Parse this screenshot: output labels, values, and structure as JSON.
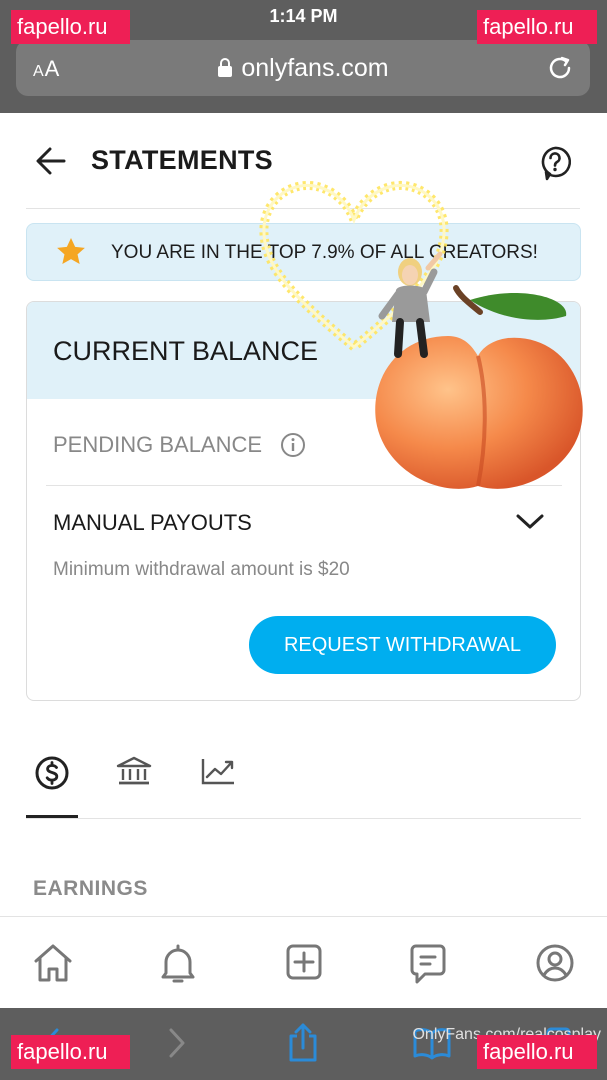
{
  "status_bar": {
    "time": "1:14 PM"
  },
  "browser": {
    "text_size_label": "AA",
    "url": "onlyfans.com",
    "icons": [
      "lock-icon",
      "reload-icon",
      "back-icon",
      "forward-icon",
      "share-icon",
      "bookmarks-icon",
      "tabs-icon"
    ]
  },
  "header": {
    "title": "STATEMENTS",
    "back_icon": "arrow-left-icon",
    "help_icon": "question-bubble-icon"
  },
  "rank_banner": {
    "text": "YOU ARE IN THE TOP 7.9% OF ALL CREATORS!",
    "icon": "star-icon",
    "icon_color": "#f5a623"
  },
  "balance": {
    "title": "CURRENT BALANCE",
    "pending_label": "PENDING BALANCE",
    "payouts_label": "MANUAL PAYOUTS",
    "min_note": "Minimum withdrawal amount is $20",
    "withdraw_button": "REQUEST WITHDRAWAL"
  },
  "tabs": {
    "items": [
      "earnings-dollar-icon",
      "bank-icon",
      "statistics-chart-icon"
    ],
    "active_index": 0
  },
  "section": {
    "heading": "EARNINGS"
  },
  "bottom_nav": {
    "items": [
      "home-icon",
      "bell-icon",
      "add-post-icon",
      "messages-icon",
      "profile-icon"
    ]
  },
  "overlay": {
    "stamp_text": "fapello.ru",
    "footer_watermark": "OnlyFans.com/realcosplay",
    "stickers": [
      "peach-emoji",
      "heart-sparkle",
      "bitmoji-avatar"
    ]
  },
  "colors": {
    "accent": "#00aeef",
    "banner_bg": "#e0f1f9",
    "chrome": "#5e5e5e",
    "stamp": "#ee1f55"
  }
}
